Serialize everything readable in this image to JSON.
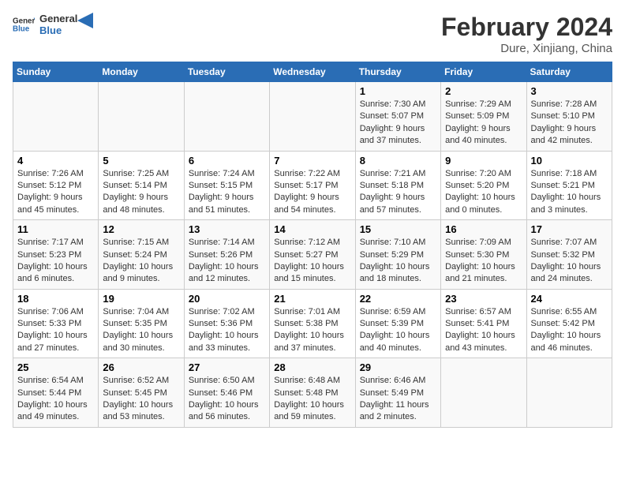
{
  "header": {
    "logo_general": "General",
    "logo_blue": "Blue",
    "title": "February 2024",
    "subtitle": "Dure, Xinjiang, China"
  },
  "columns": [
    "Sunday",
    "Monday",
    "Tuesday",
    "Wednesday",
    "Thursday",
    "Friday",
    "Saturday"
  ],
  "weeks": [
    {
      "days": [
        {
          "num": "",
          "info": ""
        },
        {
          "num": "",
          "info": ""
        },
        {
          "num": "",
          "info": ""
        },
        {
          "num": "",
          "info": ""
        },
        {
          "num": "1",
          "info": "Sunrise: 7:30 AM\nSunset: 5:07 PM\nDaylight: 9 hours\nand 37 minutes."
        },
        {
          "num": "2",
          "info": "Sunrise: 7:29 AM\nSunset: 5:09 PM\nDaylight: 9 hours\nand 40 minutes."
        },
        {
          "num": "3",
          "info": "Sunrise: 7:28 AM\nSunset: 5:10 PM\nDaylight: 9 hours\nand 42 minutes."
        }
      ]
    },
    {
      "days": [
        {
          "num": "4",
          "info": "Sunrise: 7:26 AM\nSunset: 5:12 PM\nDaylight: 9 hours\nand 45 minutes."
        },
        {
          "num": "5",
          "info": "Sunrise: 7:25 AM\nSunset: 5:14 PM\nDaylight: 9 hours\nand 48 minutes."
        },
        {
          "num": "6",
          "info": "Sunrise: 7:24 AM\nSunset: 5:15 PM\nDaylight: 9 hours\nand 51 minutes."
        },
        {
          "num": "7",
          "info": "Sunrise: 7:22 AM\nSunset: 5:17 PM\nDaylight: 9 hours\nand 54 minutes."
        },
        {
          "num": "8",
          "info": "Sunrise: 7:21 AM\nSunset: 5:18 PM\nDaylight: 9 hours\nand 57 minutes."
        },
        {
          "num": "9",
          "info": "Sunrise: 7:20 AM\nSunset: 5:20 PM\nDaylight: 10 hours\nand 0 minutes."
        },
        {
          "num": "10",
          "info": "Sunrise: 7:18 AM\nSunset: 5:21 PM\nDaylight: 10 hours\nand 3 minutes."
        }
      ]
    },
    {
      "days": [
        {
          "num": "11",
          "info": "Sunrise: 7:17 AM\nSunset: 5:23 PM\nDaylight: 10 hours\nand 6 minutes."
        },
        {
          "num": "12",
          "info": "Sunrise: 7:15 AM\nSunset: 5:24 PM\nDaylight: 10 hours\nand 9 minutes."
        },
        {
          "num": "13",
          "info": "Sunrise: 7:14 AM\nSunset: 5:26 PM\nDaylight: 10 hours\nand 12 minutes."
        },
        {
          "num": "14",
          "info": "Sunrise: 7:12 AM\nSunset: 5:27 PM\nDaylight: 10 hours\nand 15 minutes."
        },
        {
          "num": "15",
          "info": "Sunrise: 7:10 AM\nSunset: 5:29 PM\nDaylight: 10 hours\nand 18 minutes."
        },
        {
          "num": "16",
          "info": "Sunrise: 7:09 AM\nSunset: 5:30 PM\nDaylight: 10 hours\nand 21 minutes."
        },
        {
          "num": "17",
          "info": "Sunrise: 7:07 AM\nSunset: 5:32 PM\nDaylight: 10 hours\nand 24 minutes."
        }
      ]
    },
    {
      "days": [
        {
          "num": "18",
          "info": "Sunrise: 7:06 AM\nSunset: 5:33 PM\nDaylight: 10 hours\nand 27 minutes."
        },
        {
          "num": "19",
          "info": "Sunrise: 7:04 AM\nSunset: 5:35 PM\nDaylight: 10 hours\nand 30 minutes."
        },
        {
          "num": "20",
          "info": "Sunrise: 7:02 AM\nSunset: 5:36 PM\nDaylight: 10 hours\nand 33 minutes."
        },
        {
          "num": "21",
          "info": "Sunrise: 7:01 AM\nSunset: 5:38 PM\nDaylight: 10 hours\nand 37 minutes."
        },
        {
          "num": "22",
          "info": "Sunrise: 6:59 AM\nSunset: 5:39 PM\nDaylight: 10 hours\nand 40 minutes."
        },
        {
          "num": "23",
          "info": "Sunrise: 6:57 AM\nSunset: 5:41 PM\nDaylight: 10 hours\nand 43 minutes."
        },
        {
          "num": "24",
          "info": "Sunrise: 6:55 AM\nSunset: 5:42 PM\nDaylight: 10 hours\nand 46 minutes."
        }
      ]
    },
    {
      "days": [
        {
          "num": "25",
          "info": "Sunrise: 6:54 AM\nSunset: 5:44 PM\nDaylight: 10 hours\nand 49 minutes."
        },
        {
          "num": "26",
          "info": "Sunrise: 6:52 AM\nSunset: 5:45 PM\nDaylight: 10 hours\nand 53 minutes."
        },
        {
          "num": "27",
          "info": "Sunrise: 6:50 AM\nSunset: 5:46 PM\nDaylight: 10 hours\nand 56 minutes."
        },
        {
          "num": "28",
          "info": "Sunrise: 6:48 AM\nSunset: 5:48 PM\nDaylight: 10 hours\nand 59 minutes."
        },
        {
          "num": "29",
          "info": "Sunrise: 6:46 AM\nSunset: 5:49 PM\nDaylight: 11 hours\nand 2 minutes."
        },
        {
          "num": "",
          "info": ""
        },
        {
          "num": "",
          "info": ""
        }
      ]
    }
  ]
}
